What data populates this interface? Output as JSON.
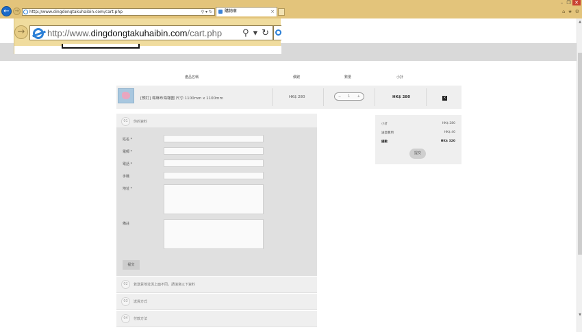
{
  "browser": {
    "url": "http://www.dingdongtakuhaibin.com/cart.php",
    "url_prefix": "http://www.",
    "url_domain": "dingdongtakuhaibin.com",
    "url_path": "/cart.php",
    "tab_title": "購物車",
    "window_controls": {
      "minimize": "–",
      "maximize": "❐",
      "close": "✕"
    },
    "nav": {
      "back": "←",
      "forward": "→"
    },
    "tools": {
      "search": "⚲",
      "dropdown": "▾",
      "refresh": "↻"
    },
    "cmd_icons": [
      "⌂",
      "★",
      "⚙"
    ]
  },
  "cart": {
    "headers": {
      "name": "產品名稱",
      "price": "價錢",
      "qty": "數量",
      "subtotal": "小計"
    },
    "items": [
      {
        "name": "[預訂] 棉麻布海報圖 尺寸:1100mm x 1100mm",
        "price": "HK$ 280",
        "qty": "1",
        "qty_minus": "−",
        "qty_plus": "+",
        "subtotal": "HK$ 280",
        "remove": "×"
      }
    ]
  },
  "checkout": {
    "steps": [
      {
        "num": "01",
        "title": "你的資料"
      },
      {
        "num": "02",
        "title": "若送貨地址與上面不同，請填寫以下資料"
      },
      {
        "num": "03",
        "title": "送貨方式"
      },
      {
        "num": "04",
        "title": "付款方法"
      }
    ],
    "fields": {
      "name": "姓名 *",
      "email": "電郵 *",
      "phone": "電話 *",
      "mobile": "手機",
      "address": "地址 *",
      "remarks": "備註"
    },
    "submit_label": "提交"
  },
  "summary": {
    "subtotal_label": "小計",
    "subtotal_value": "HK$ 280",
    "shipping_label": "送貨費用",
    "shipping_value": "HK$ 40",
    "total_label": "總數",
    "total_value": "HK$ 320",
    "submit_label": "提交"
  }
}
